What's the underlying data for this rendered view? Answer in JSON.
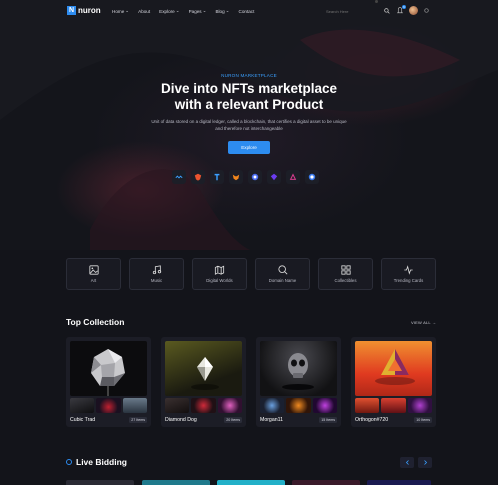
{
  "header": {
    "logo_letter": "N",
    "logo_text": "nuron",
    "nav": [
      "Home",
      "About",
      "Explore",
      "Pages",
      "Blog",
      "Contact"
    ],
    "search_placeholder": "Search Here",
    "notification_count": "6"
  },
  "hero": {
    "kicker": "NURON MARKETPLACE",
    "title_line1": "Dive into NFTs marketplace",
    "title_line2": "with a relevant Product",
    "subtitle": "Unit of data stored on a digital ledger, called a blockchain, that certifies a digital asset to be unique and therefore not interchangeable",
    "button": "Explore",
    "partners": [
      "waves-icon",
      "brave-icon",
      "tezos-icon",
      "metamask-icon",
      "coin-icon",
      "polygon-icon",
      "arweave-icon",
      "circle-icon"
    ]
  },
  "categories": [
    {
      "label": "Art",
      "icon": "image-icon"
    },
    {
      "label": "Music",
      "icon": "music-icon"
    },
    {
      "label": "Digital Worlds",
      "icon": "map-icon"
    },
    {
      "label": "Domain Name",
      "icon": "search-icon"
    },
    {
      "label": "Collectibles",
      "icon": "grid-icon"
    },
    {
      "label": "Trending Cards",
      "icon": "activity-icon"
    }
  ],
  "collection": {
    "title": "Top Collection",
    "view_all": "VIEW ALL →",
    "items": [
      {
        "name": "Cubic Trad",
        "count": "27 Items"
      },
      {
        "name": "Diamond Dog",
        "count": "20 Items"
      },
      {
        "name": "Morgan11",
        "count": "15 Items"
      },
      {
        "name": "Orthogon#720",
        "count": "10 Items"
      }
    ]
  },
  "live": {
    "title": "Live Bidding"
  },
  "colors": {
    "accent": "#2d8cf0",
    "background": "#13141a",
    "card": "#1c1d26"
  }
}
